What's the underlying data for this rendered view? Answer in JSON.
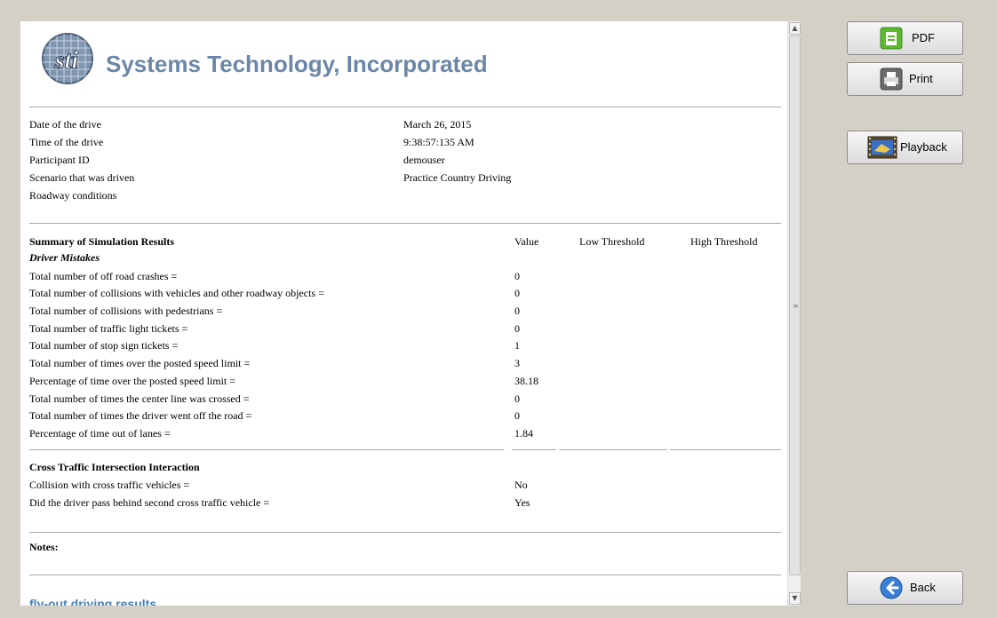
{
  "header": {
    "company_name": "Systems Technology, Incorporated",
    "logo_text": "sti"
  },
  "drive_info": [
    {
      "label": "Date of the drive",
      "value": "March 26, 2015"
    },
    {
      "label": "Time of the drive",
      "value": "9:38:57:135 AM"
    },
    {
      "label": "Participant ID",
      "value": "demouser"
    },
    {
      "label": "Scenario that was driven",
      "value": "Practice Country Driving"
    },
    {
      "label": "Roadway conditions",
      "value": ""
    }
  ],
  "summary": {
    "title": "Summary of Simulation Results",
    "columns": {
      "value": "Value",
      "low": "Low Threshold",
      "high": "High Threshold"
    },
    "subheading": "Driver Mistakes",
    "rows": [
      {
        "label": "Total number of off road crashes =",
        "value": "0"
      },
      {
        "label": "Total number of collisions with vehicles and other roadway objects =",
        "value": "0"
      },
      {
        "label": "Total number of collisions with pedestrians =",
        "value": "0"
      },
      {
        "label": "Total number of traffic light tickets =",
        "value": "0"
      },
      {
        "label": "Total number of stop sign tickets =",
        "value": "1"
      },
      {
        "label": "Total number of times over the posted speed limit =",
        "value": "3"
      },
      {
        "label": "Percentage of time over the posted speed limit =",
        "value": "38.18"
      },
      {
        "label": "Total number of times the center line was crossed =",
        "value": "0"
      },
      {
        "label": "Total number of times the driver went off the road =",
        "value": "0"
      },
      {
        "label": "Percentage of time out of lanes =",
        "value": "1.84"
      }
    ]
  },
  "cross_traffic": {
    "title": "Cross Traffic Intersection Interaction",
    "rows": [
      {
        "label": "Collision with cross traffic vehicles =",
        "value": "No"
      },
      {
        "label": "Did the driver pass behind second cross traffic vehicle =",
        "value": "Yes"
      }
    ]
  },
  "notes": {
    "label": "Notes:"
  },
  "footer": {
    "text": "fly-out driving results"
  },
  "buttons": {
    "pdf": "PDF",
    "print": "Print",
    "playback": "Playback",
    "back": "Back"
  },
  "colors": {
    "company_blue": "#6b87a8",
    "panel_bg": "#d4d0c8",
    "back_icon": "#3a7fd5",
    "pdf_icon": "#5cb82e"
  }
}
